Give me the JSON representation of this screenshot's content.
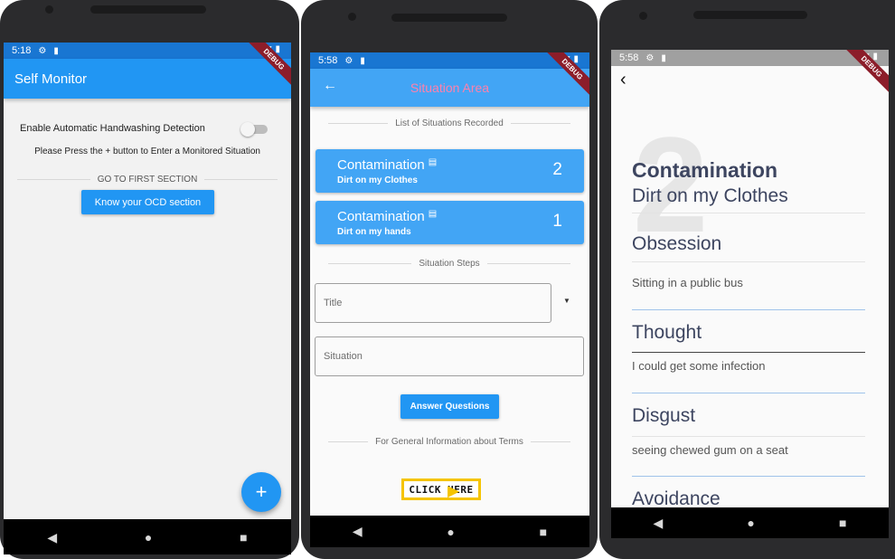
{
  "phone1": {
    "time": "5:18",
    "app_title": "Self Monitor",
    "handwash_label": "Enable Automatic Handwashing Detection",
    "instruction": "Please Press the + button to Enter a Monitored Situation",
    "section_label": "GO TO FIRST SECTION",
    "ocd_button": "Know your OCD section",
    "fab_label": "+",
    "debug": "DEBUG"
  },
  "phone2": {
    "time": "5:58",
    "title": "Situation Area",
    "recorded_label": "List of Situations Recorded",
    "situations": [
      {
        "title": "Contamination",
        "subtitle": "Dirt on my Clothes",
        "count": "2"
      },
      {
        "title": "Contamination",
        "subtitle": "Dirt on my hands",
        "count": "1"
      }
    ],
    "steps_label": "Situation Steps",
    "title_placeholder": "Title",
    "situation_placeholder": "Situation",
    "answer_button": "Answer Questions",
    "info_label": "For General Information about Terms",
    "click_here": "CLICK HERE",
    "debug": "DEBUG"
  },
  "phone3": {
    "time": "5:58",
    "big_number": "2",
    "heading": "Contamination",
    "subheading": "Dirt on my Clothes",
    "sections": [
      {
        "label": "Obsession",
        "value": "Sitting in a public bus"
      },
      {
        "label": "Thought",
        "value": "I could get some infection"
      },
      {
        "label": "Disgust",
        "value": "seeing chewed gum on a seat"
      },
      {
        "label": "Avoidance",
        "value": ""
      }
    ],
    "debug": "DEBUG"
  },
  "colors": {
    "primary": "#2196f3",
    "card": "#42a5f5",
    "appbar_title_pink": "#ff80ab",
    "heading_dark": "#3d4560",
    "debug_banner": "#8c1d2a"
  },
  "icons": {
    "settings": "gear-icon",
    "sd": "sd-card-icon",
    "wifi": "wifi-icon",
    "battery": "battery-icon",
    "back": "back-arrow-icon",
    "dropdown": "dropdown-arrow-icon",
    "nav_back": "nav-back-icon",
    "nav_home": "nav-home-icon",
    "nav_recents": "nav-recents-icon"
  }
}
